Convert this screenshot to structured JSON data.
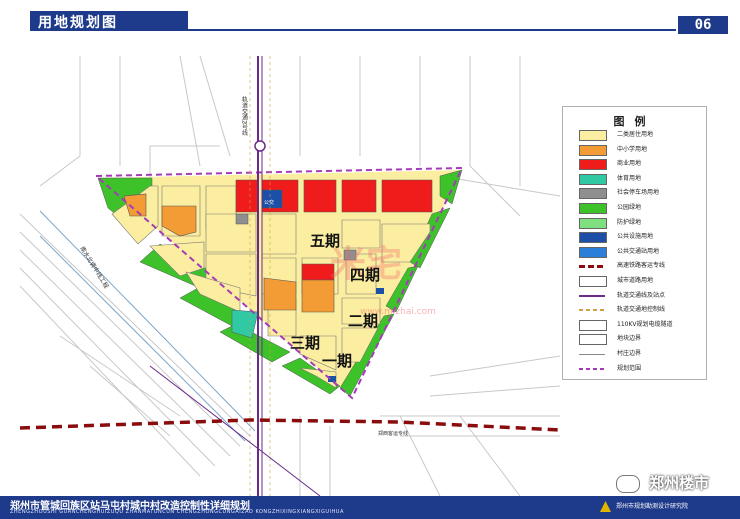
{
  "header": {
    "title": "用地规划图",
    "page_number": "06"
  },
  "map": {
    "phases": [
      "五期",
      "四期",
      "二期",
      "三期",
      "一期"
    ],
    "streets": {
      "metro_line_2": "轨道交通2号线",
      "nanshui_beidiao": "南水北调中线工程",
      "zhengxi_rail": "郑西客运专线"
    },
    "plot_labels": {
      "public_toilet": "公交"
    },
    "watermark_center": "www.mizhai.com",
    "watermark_center_big": "米宅"
  },
  "legend": {
    "title": "图例",
    "items": [
      {
        "label": "二类居住用地",
        "color": "#fbeea0",
        "icon": "swatch"
      },
      {
        "label": "中小学用地",
        "color": "#f39c35",
        "icon": "school-swatch"
      },
      {
        "label": "商业用地",
        "color": "#f01c1c",
        "icon": "swatch"
      },
      {
        "label": "体育用地",
        "color": "#30c9a4",
        "icon": "sports-swatch"
      },
      {
        "label": "社会停车场用地",
        "color": "#8f8f8f",
        "icon": "parking-swatch"
      },
      {
        "label": "公园绿地",
        "color": "#3ec22a",
        "icon": "swatch"
      },
      {
        "label": "防护绿地",
        "color": "#7ee07e",
        "icon": "swatch"
      },
      {
        "label": "公共设施用地",
        "color": "#1c4fa8",
        "icon": "swatch"
      },
      {
        "label": "公共交通站用地",
        "color": "#2c7fd8",
        "icon": "swatch"
      },
      {
        "label": "高速铁路客运专线",
        "color": "#8a0c0c",
        "icon": "rail-line"
      },
      {
        "label": "城市道路用地",
        "color": "#ffffff",
        "icon": "swatch"
      },
      {
        "label": "轨道交通线及站点",
        "color": "#6a2a8a",
        "icon": "metro-line"
      },
      {
        "label": "轨道交通地控制线",
        "color": "#d0a040",
        "icon": "dashed-line"
      },
      {
        "label": "110KV规划电缆隧道",
        "color": "#ffffff",
        "icon": "swatch"
      },
      {
        "label": "地块边界",
        "color": "#ffffff",
        "icon": "swatch"
      },
      {
        "label": "村庄边界",
        "color": "#888888",
        "icon": "boundary-line"
      },
      {
        "label": "规划范围",
        "color": "#a53bb8",
        "icon": "dashed-boundary"
      }
    ]
  },
  "footer": {
    "title": "郑州市管城回族区站马屯村城中村改造控制性详细规划",
    "pinyin": "ZHENGZHOUSHI GUANCHENGHUIZUQU ZHANMATUNCUN CHENGZHONGCUNGAIZAO KONGZHIXINGXIANGXIGUIHUA",
    "org": "郑州市规划勘测设计研究院"
  },
  "watermark": {
    "text": "郑州楼市"
  }
}
